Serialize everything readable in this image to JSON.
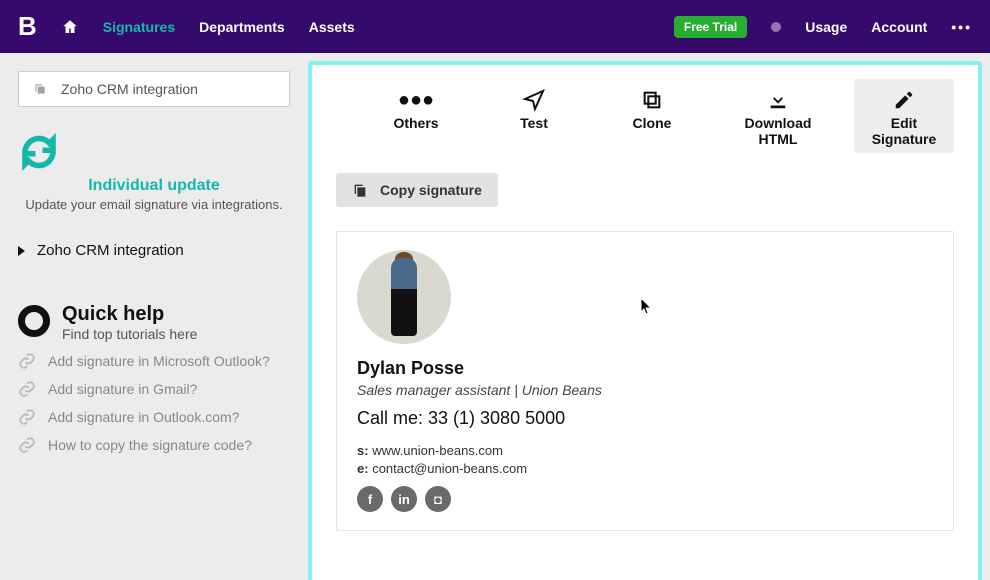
{
  "nav": {
    "brand": "B",
    "items": [
      "Signatures",
      "Departments",
      "Assets"
    ],
    "trial": "Free Trial",
    "usage": "Usage",
    "account": "Account"
  },
  "sidebar": {
    "selector": "Zoho CRM integration",
    "individual": {
      "title": "Individual update",
      "sub": "Update your email signature via integrations."
    },
    "tree_item": "Zoho CRM integration",
    "quick": {
      "title": "Quick help",
      "sub": "Find top tutorials here"
    },
    "links": [
      "Add signature in Microsoft Outlook?",
      "Add signature in Gmail?",
      "Add signature in Outlook.com?",
      "How to copy the signature code?"
    ]
  },
  "actions": {
    "others": "Others",
    "test": "Test",
    "clone": "Clone",
    "download": "Download HTML",
    "edit": "Edit Signature",
    "copy": "Copy signature"
  },
  "sig": {
    "name": "Dylan Posse",
    "role": "Sales manager assistant | Union Beans",
    "phone": "Call me: 33 (1) 3080 5000",
    "site_label": "s:",
    "site": "www.union-beans.com",
    "email_label": "e:",
    "email": "contact@union-beans.com",
    "social": {
      "fb": "f",
      "li": "in",
      "ig": "◘"
    }
  }
}
